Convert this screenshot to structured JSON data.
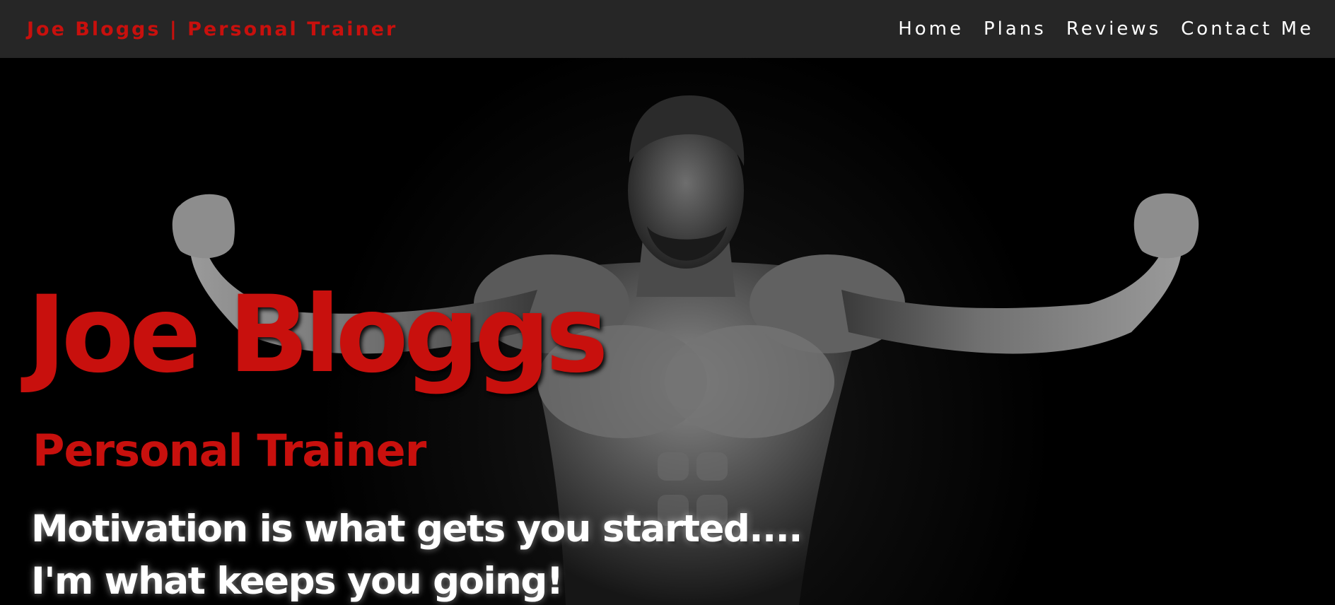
{
  "header": {
    "brand": "Joe Bloggs | Personal Trainer",
    "nav": [
      {
        "label": "Home"
      },
      {
        "label": "Plans"
      },
      {
        "label": "Reviews"
      },
      {
        "label": "Contact Me"
      }
    ]
  },
  "hero": {
    "title": "Joe Bloggs",
    "subtitle": "Personal Trainer",
    "quote_line1": "Motivation is what gets you started....",
    "quote_line2": "I'm what keeps you going!",
    "image_subject": "flexing-man-photo"
  },
  "colors": {
    "accent": "#c8100d",
    "navbar_bg": "#262626",
    "hero_bg": "#000000",
    "nav_text": "#ffffff"
  }
}
